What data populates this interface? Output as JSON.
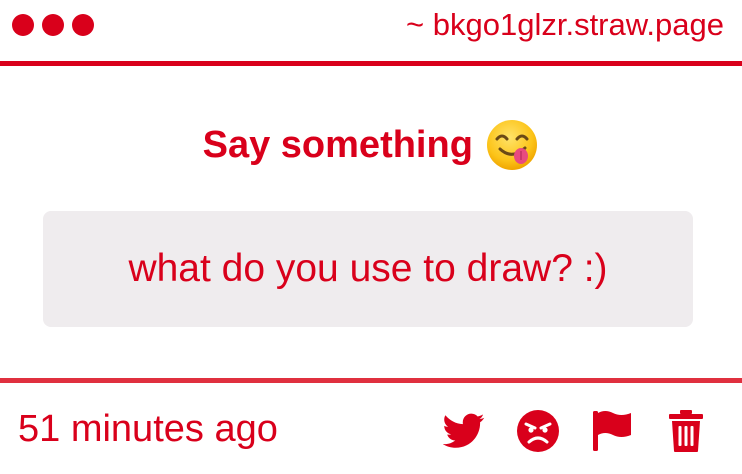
{
  "header": {
    "site_url": "~ bkgo1glzr.straw.page"
  },
  "main": {
    "title": "Say something",
    "title_emoji": "face-savoring-food-icon",
    "message": "what do you use to draw? :)"
  },
  "footer": {
    "timestamp": "51 minutes ago",
    "actions": [
      {
        "name": "twitter-icon"
      },
      {
        "name": "angry-face-icon"
      },
      {
        "name": "flag-icon"
      },
      {
        "name": "trash-icon"
      }
    ]
  },
  "colors": {
    "accent": "#d9001b",
    "message_background": "#efecee"
  }
}
